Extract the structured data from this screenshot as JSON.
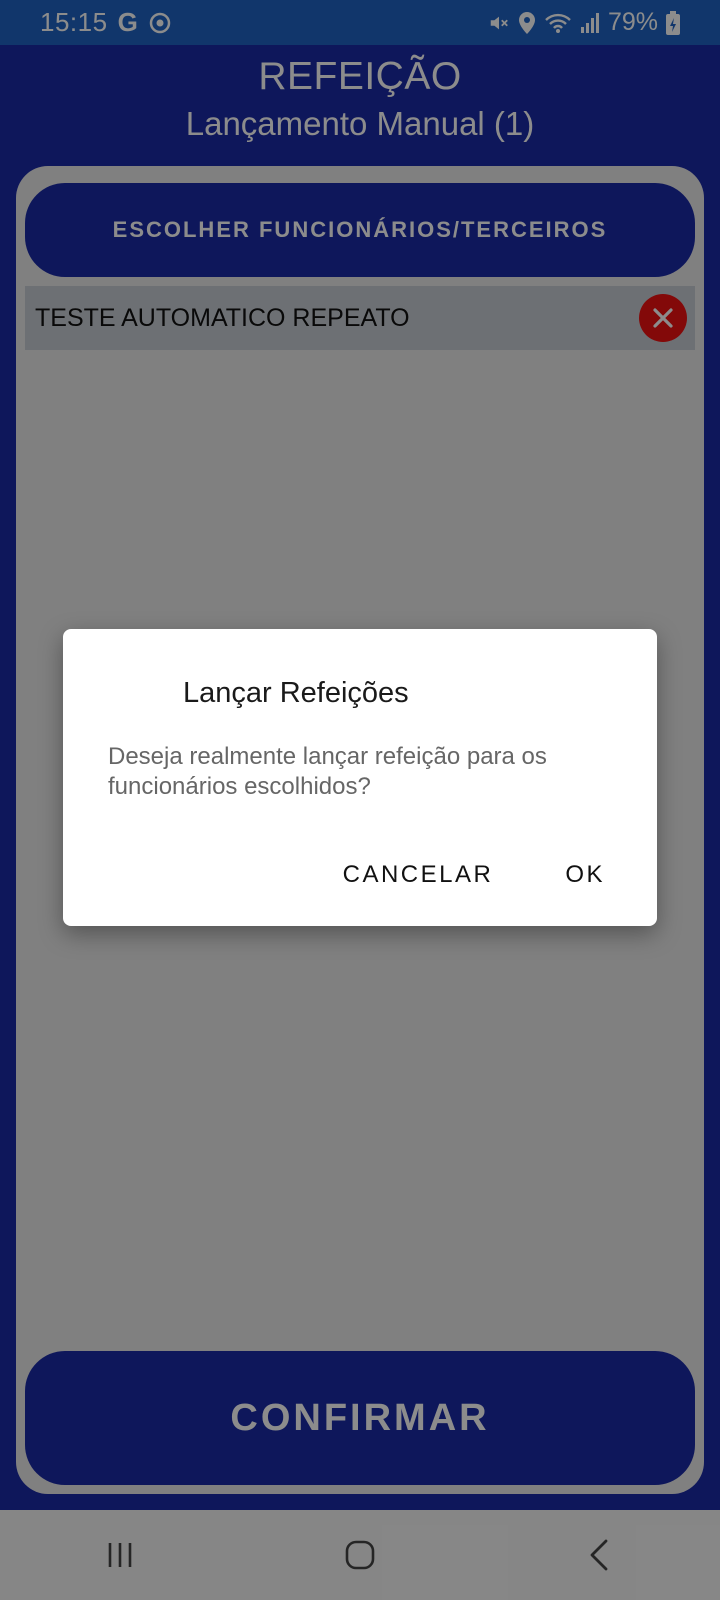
{
  "status_bar": {
    "time": "15:15",
    "g_label": "G",
    "battery": "79%",
    "icons": [
      "google-icon",
      "sync-icon",
      "mute-icon",
      "location-icon",
      "wifi-icon",
      "signal-icon",
      "battery-icon"
    ]
  },
  "header": {
    "title": "REFEIÇÃO",
    "subtitle": "Lançamento Manual (1)"
  },
  "choose_button": {
    "label": "ESCOLHER FUNCIONÁRIOS/TERCEIROS"
  },
  "selected_list": [
    {
      "label": "TESTE AUTOMATICO REPEATO"
    }
  ],
  "confirm_button": {
    "label": "CONFIRMAR"
  },
  "dialog": {
    "title": "Lançar Refeições",
    "message": "Deseja realmente lançar refeição para os funcionários escolhidos?",
    "cancel_label": "CANCELAR",
    "ok_label": "OK"
  },
  "navbar": {
    "icons": [
      "recents-icon",
      "home-icon",
      "back-icon"
    ]
  },
  "colors": {
    "primary": "#1b2aa6",
    "status_bar": "#1f63c4",
    "remove": "#ee1111"
  }
}
